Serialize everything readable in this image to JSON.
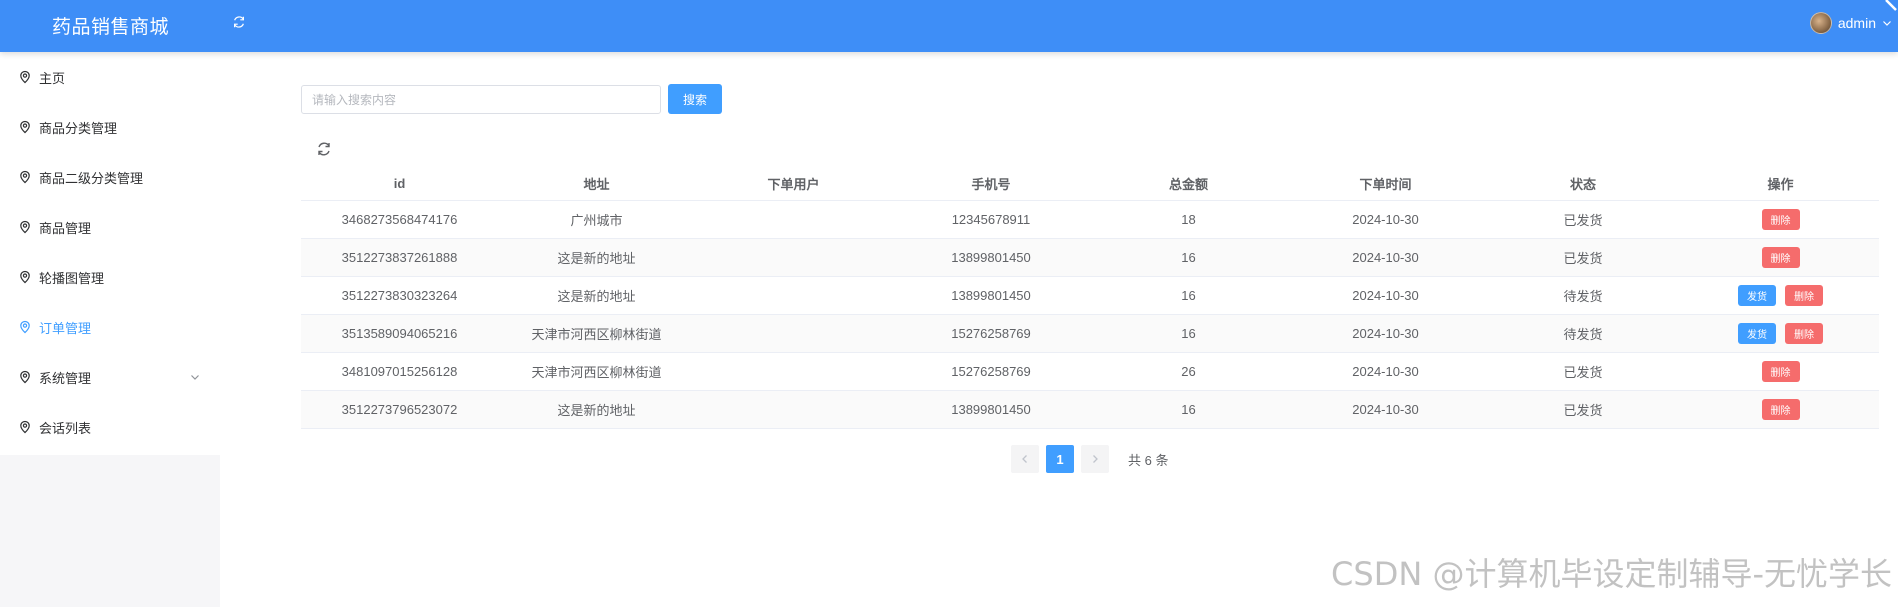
{
  "header": {
    "title": "药品销售商城",
    "username": "admin",
    "refresh_icon": "refresh-icon",
    "accent": "#3e8ef7"
  },
  "sidebar": {
    "items": [
      {
        "label": "主页",
        "icon": "location-pin-icon"
      },
      {
        "label": "商品分类管理",
        "icon": "location-pin-icon"
      },
      {
        "label": "商品二级分类管理",
        "icon": "location-pin-icon"
      },
      {
        "label": "商品管理",
        "icon": "location-pin-icon"
      },
      {
        "label": "轮播图管理",
        "icon": "location-pin-icon"
      },
      {
        "label": "订单管理",
        "icon": "location-pin-icon",
        "active": true
      },
      {
        "label": "系统管理",
        "icon": "location-pin-icon",
        "expandable": true
      },
      {
        "label": "会话列表",
        "icon": "location-pin-icon"
      }
    ],
    "active_color": "#409eff"
  },
  "search": {
    "placeholder": "请输入搜索内容",
    "value": "",
    "button_label": "搜索"
  },
  "table": {
    "columns": [
      "id",
      "地址",
      "下单用户",
      "手机号",
      "总金额",
      "下单时间",
      "状态",
      "操作"
    ],
    "rows": [
      {
        "id": "3468273568474176",
        "address": "广州城市",
        "user": "",
        "phone": "12345678911",
        "total": "18",
        "time": "2024-10-30",
        "status": "已发货",
        "can_ship": false
      },
      {
        "id": "3512273837261888",
        "address": "这是新的地址",
        "user": "",
        "phone": "13899801450",
        "total": "16",
        "time": "2024-10-30",
        "status": "已发货",
        "can_ship": false
      },
      {
        "id": "3512273830323264",
        "address": "这是新的地址",
        "user": "",
        "phone": "13899801450",
        "total": "16",
        "time": "2024-10-30",
        "status": "待发货",
        "can_ship": true
      },
      {
        "id": "3513589094065216",
        "address": "天津市河西区柳林街道",
        "user": "",
        "phone": "15276258769",
        "total": "16",
        "time": "2024-10-30",
        "status": "待发货",
        "can_ship": true
      },
      {
        "id": "3481097015256128",
        "address": "天津市河西区柳林街道",
        "user": "",
        "phone": "15276258769",
        "total": "26",
        "time": "2024-10-30",
        "status": "已发货",
        "can_ship": false
      },
      {
        "id": "3512273796523072",
        "address": "这是新的地址",
        "user": "",
        "phone": "13899801450",
        "total": "16",
        "time": "2024-10-30",
        "status": "已发货",
        "can_ship": false
      }
    ],
    "ship_label": "发货",
    "delete_label": "删除",
    "ship_color": "#409eff",
    "delete_color": "#f56c6c"
  },
  "pagination": {
    "current_page": "1",
    "total_text": "共 6 条"
  },
  "watermark": "CSDN @计算机毕设定制辅导-无忧学长"
}
